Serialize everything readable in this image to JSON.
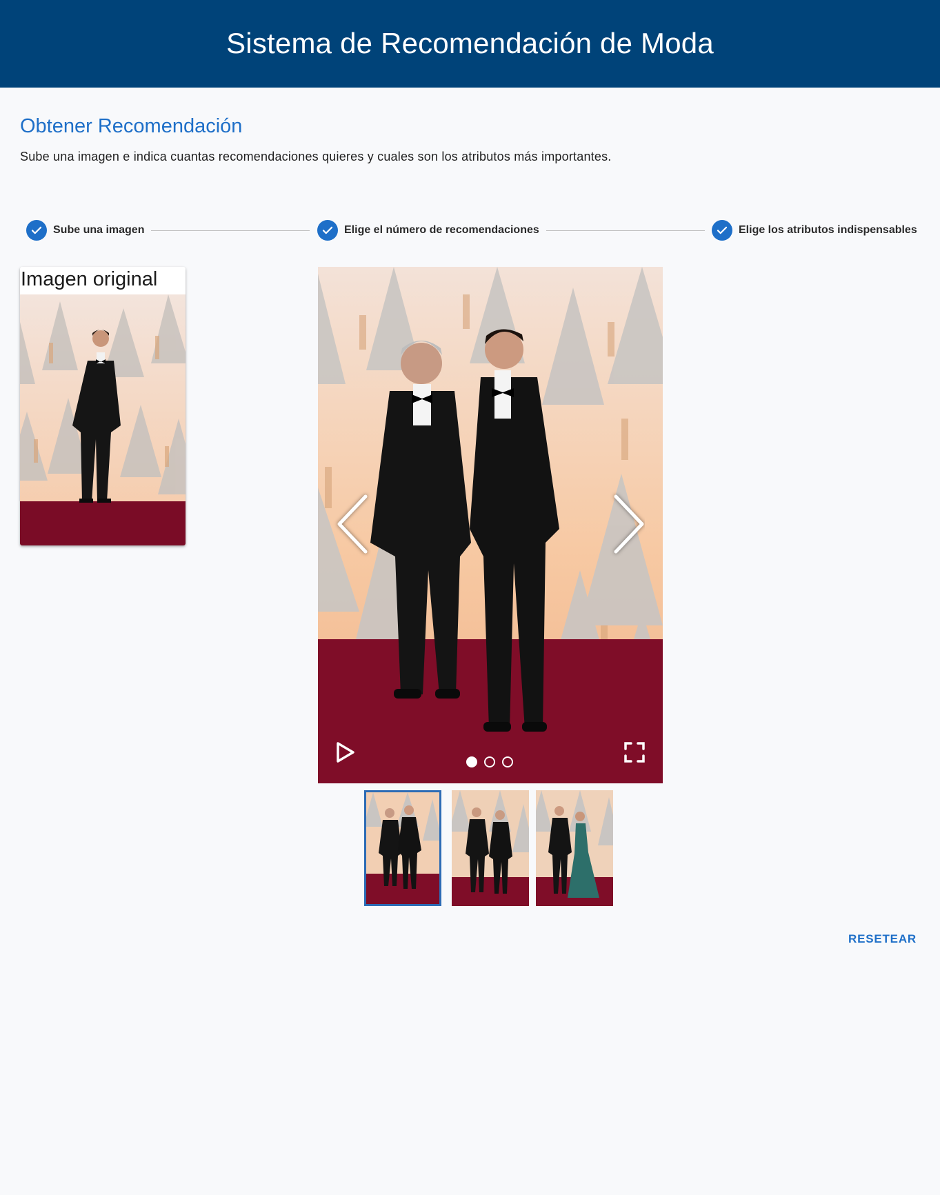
{
  "header": {
    "title": "Sistema de Recomendación de Moda"
  },
  "section": {
    "title": "Obtener Recomendación",
    "description": "Sube una imagen e indica cuantas recomendaciones quieres y cuales son los atributos más importantes."
  },
  "stepper": {
    "steps": [
      {
        "label": "Sube una imagen",
        "completed": true
      },
      {
        "label": "Elige el número de recomendaciones",
        "completed": true
      },
      {
        "label": "Elige los atributos indispensables",
        "completed": true
      }
    ]
  },
  "original": {
    "title": "Imagen original"
  },
  "gallery": {
    "current_index": 0,
    "total": 3,
    "icons": [
      "chevron-left-icon",
      "chevron-right-icon",
      "play-icon",
      "fullscreen-icon"
    ]
  },
  "actions": {
    "reset_label": "RESETEAR"
  },
  "colors": {
    "header_bg": "#004379",
    "accent": "#1e6fc8",
    "carpet": "#7a0c26"
  }
}
